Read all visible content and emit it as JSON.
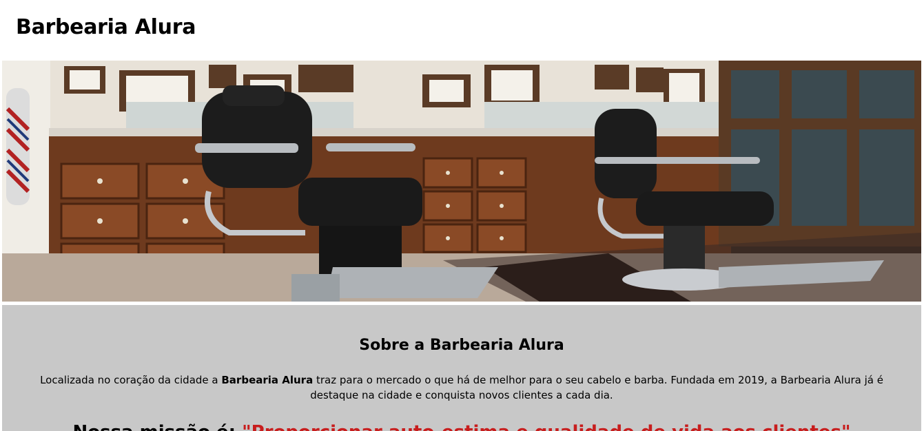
{
  "header": {
    "title": "Barbearia Alura"
  },
  "hero": {
    "image": "barbershop-interior-photo"
  },
  "about": {
    "title": "Sobre a Barbearia Alura",
    "text_before": "Localizada no coração da cidade a ",
    "brand": "Barbearia Alura",
    "text_after": " traz para o mercado o que há de melhor para o seu cabelo e barba. Fundada em 2019, a Barbearia Alura já é destaque na cidade e conquista novos clientes a cada dia.",
    "mission_label": "Nossa missão é: ",
    "mission_quote": "\"Proporcionar auto-estima e qualidade de vida aos clientes\""
  },
  "colors": {
    "about_bg": "#c8c8c8",
    "mission_quote": "#c81d1d"
  }
}
